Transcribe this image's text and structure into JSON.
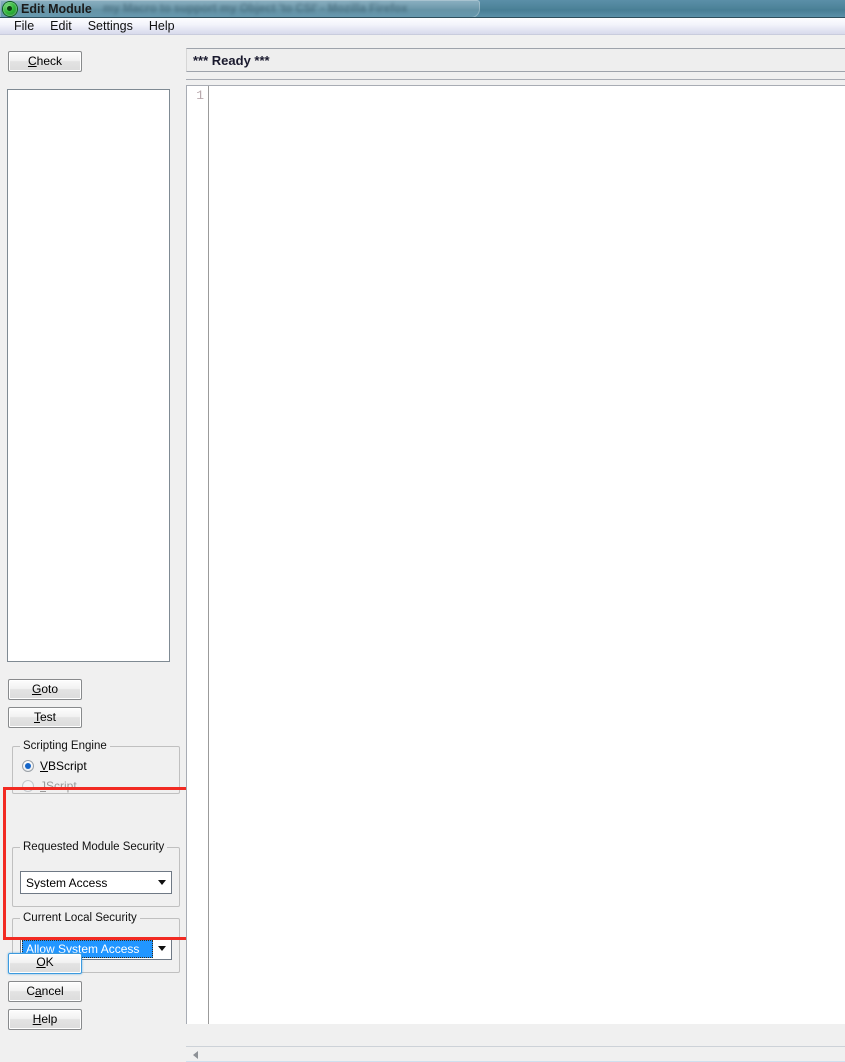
{
  "window": {
    "title": "Edit Module",
    "icon": "green-circle-icon",
    "background_ghost_title": "my Macro to support my Object 'to CSI' - Mozilla Firefox"
  },
  "menubar": {
    "items": [
      {
        "label": "File"
      },
      {
        "label": "Edit"
      },
      {
        "label": "Settings"
      },
      {
        "label": "Help"
      }
    ]
  },
  "toolbar": {
    "check_label": "Check",
    "check_accel": "C"
  },
  "status": {
    "text": "*** Ready ***"
  },
  "sidebar": {
    "listbox_items": [],
    "goto_label": "Goto",
    "goto_accel": "G",
    "test_label": "Test",
    "test_accel": "T"
  },
  "scripting_engine": {
    "group_title": "Scripting Engine",
    "options": [
      {
        "label": "VBScript",
        "accel": "V",
        "selected": true,
        "disabled": false
      },
      {
        "label": "JScript",
        "accel": "J",
        "selected": false,
        "disabled": true
      }
    ]
  },
  "requested_module_security": {
    "group_title": "Requested Module Security",
    "value": "System Access",
    "options": [
      "System Access"
    ]
  },
  "current_local_security": {
    "group_title": "Current Local Security",
    "value": "Allow System Access",
    "options": [
      "Allow System Access"
    ],
    "highlighted": true,
    "highlight_color": "#2196ff"
  },
  "dialog_buttons": {
    "ok_label": "OK",
    "ok_accel": "O",
    "cancel_label": "Cancel",
    "cancel_accel": "C",
    "help_label": "Help",
    "help_accel": "H"
  },
  "editor": {
    "line_numbers": [
      "1"
    ],
    "content": ""
  },
  "annotation": {
    "shape": "rectangle",
    "color": "#f22a22"
  }
}
